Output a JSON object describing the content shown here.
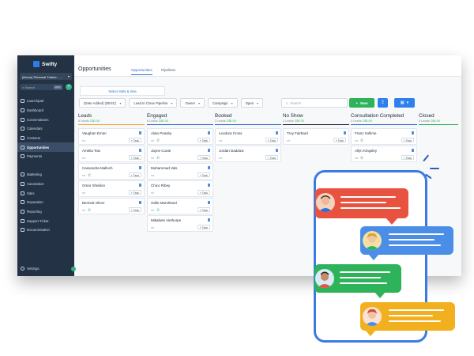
{
  "app": {
    "brand": "Swifty",
    "account": "(Demo) Personal Trainer - ...",
    "search_placeholder": "Search",
    "search_shortcut": "ctrl K"
  },
  "sidebar": {
    "items": [
      {
        "label": "Launchpad",
        "icon": "rocket-icon"
      },
      {
        "label": "Dashboard",
        "icon": "dashboard-icon"
      },
      {
        "label": "Conversations",
        "icon": "chat-icon"
      },
      {
        "label": "Calendars",
        "icon": "calendar-icon"
      },
      {
        "label": "Contacts",
        "icon": "contacts-icon"
      },
      {
        "label": "Opportunities",
        "icon": "funnel-icon",
        "active": true
      },
      {
        "label": "Payments",
        "icon": "payments-icon"
      }
    ],
    "items2": [
      {
        "label": "Marketing",
        "icon": "megaphone-icon"
      },
      {
        "label": "Automation",
        "icon": "automation-icon"
      },
      {
        "label": "Sites",
        "icon": "globe-icon"
      },
      {
        "label": "Reputation",
        "icon": "star-icon"
      },
      {
        "label": "Reporting",
        "icon": "chart-icon"
      },
      {
        "label": "Support Ticket",
        "icon": "ticket-icon"
      },
      {
        "label": "Documentation",
        "icon": "book-icon"
      }
    ],
    "settings": "Settings"
  },
  "header": {
    "title": "Opportunities",
    "tabs": [
      "Opportunities",
      "Pipelines"
    ],
    "select_link": "Select stats & time"
  },
  "filters": {
    "sort": "(Date Added) (DESC)",
    "pipeline": "Lead to Close Pipeline",
    "owner": "Owner",
    "campaign": "Campaign",
    "status": "Open",
    "search_placeholder": "Search",
    "new_label": "New"
  },
  "columns": [
    {
      "title": "Leads",
      "count": "5 Leads",
      "amount": "C$0.00",
      "color": "#f2a33a"
    },
    {
      "title": "Engaged",
      "count": "6 Leads",
      "amount": "C$0.00",
      "color": "#2f6fd8"
    },
    {
      "title": "Booked",
      "count": "2 Leads",
      "amount": "C$0.00",
      "color": "#2f6fd8"
    },
    {
      "title": "No Show",
      "count": "1 Leads",
      "amount": "C$0.00",
      "color": "#1e2a36"
    },
    {
      "title": "Consultation Completed",
      "count": "2 Leads",
      "amount": "C$0.00",
      "color": "#2f6fd8"
    },
    {
      "title": "Closed",
      "count": "0 Leads",
      "amount": "C$0.00",
      "color": "#2fb35a"
    }
  ],
  "cards": {
    "leads": [
      "Vaughan Eman",
      "Amelia Tow",
      "Cassandra Malloch",
      "Omar Sheldon",
      "Bennett Oliver"
    ],
    "engaged": [
      "Alain Peasby",
      "Jayne Coote",
      "Muhammad Vals",
      "Chico Ribey",
      "Odile Marshland",
      "Mikabele Alethorpe"
    ],
    "booked": [
      "Leodora Cross",
      "Jordan Daddow"
    ],
    "noshow": [
      "Troy Fairbard"
    ],
    "consultation": [
      "Franz Sollime",
      "Allyn Kingsley"
    ]
  },
  "task_label": "+ Task",
  "illustration": {
    "bubble_colors": [
      "#e8533f",
      "#4b8ee8",
      "#2fb35a",
      "#f2b01e"
    ]
  }
}
